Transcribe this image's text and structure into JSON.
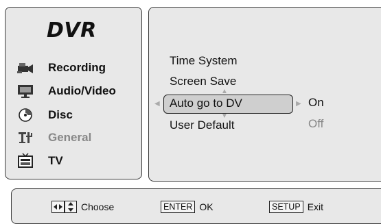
{
  "left_menu": {
    "title": "DVR",
    "items": [
      {
        "label": "Recording",
        "icon": "camcorder-icon"
      },
      {
        "label": "Audio/Video",
        "icon": "monitor-icon"
      },
      {
        "label": "Disc",
        "icon": "disc-icon"
      },
      {
        "label": "General",
        "icon": "general-tools-icon"
      },
      {
        "label": "TV",
        "icon": "tv-icon"
      }
    ]
  },
  "options": {
    "items": [
      "Time System",
      "Screen Save",
      "Auto go to DV",
      "User Default"
    ],
    "selected": "Auto go to DV",
    "values": [
      "On",
      "Off"
    ],
    "current_value": "On"
  },
  "footer": {
    "choose_label": "Choose",
    "enter_key": "ENTER",
    "ok_label": "OK",
    "setup_key": "SETUP",
    "exit_label": "Exit"
  },
  "colors": {
    "panel_bg": "#e8e8e8",
    "border": "#3a3a3a",
    "highlight_bg": "#cfcfcf",
    "dim_text": "#888888"
  }
}
